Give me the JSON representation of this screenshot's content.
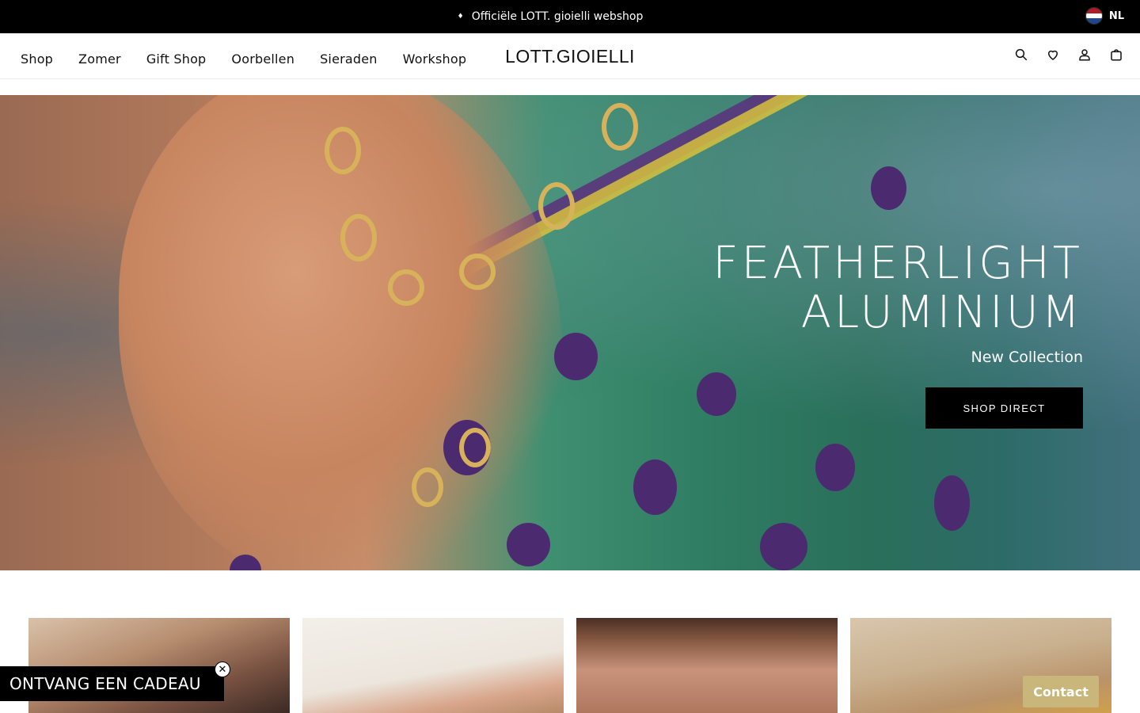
{
  "announcement": {
    "bullet": "♦",
    "text": "Officiële LOTT. gioielli webshop",
    "language": "NL"
  },
  "header": {
    "nav": [
      "Shop",
      "Zomer",
      "Gift Shop",
      "Oorbellen",
      "Sieraden",
      "Workshop"
    ],
    "logo": "LOTT.GIOIELLI",
    "icons": [
      "search-icon",
      "heart-icon",
      "user-icon",
      "cart-icon"
    ]
  },
  "hero": {
    "title_line1": "FEATHERLIGHT",
    "title_line2": "ALUMINIUM",
    "subtitle": "New Collection",
    "button": "SHOP DIRECT"
  },
  "gift_popup": {
    "label": "ONTVANG EEN CADEAU",
    "close": "✕"
  },
  "contact_button": "Contact",
  "colors": {
    "announce_bg": "#000000",
    "button_bg": "#000000",
    "contact_bg": "#c8b67a",
    "flag": [
      "#ae1c28",
      "#ffffff",
      "#21468b"
    ]
  }
}
